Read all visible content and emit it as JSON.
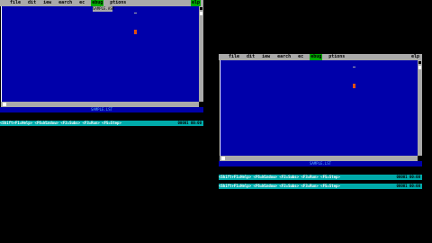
{
  "windows": [
    {
      "menu": [
        {
          "label": "file",
          "highlighted": false
        },
        {
          "label": "dit",
          "highlighted": false
        },
        {
          "label": "iew",
          "highlighted": false
        },
        {
          "label": "earch",
          "highlighted": false
        },
        {
          "label": "ec",
          "highlighted": false
        },
        {
          "label": "ebug",
          "highlighted": true
        },
        {
          "label": "ptions",
          "highlighted": false
        }
      ],
      "help_label": "elp",
      "title": "SAMPLE.ASM",
      "status_label": "SAMPLE.LST",
      "funcbars": [
        {
          "text": "<Shift+F1=Help> <F6=Window> <F2=Subs> <F3=Run> <F5=Step>",
          "right": "00001 00:00"
        }
      ]
    },
    {
      "menu": [
        {
          "label": "file",
          "highlighted": false
        },
        {
          "label": "dit",
          "highlighted": false
        },
        {
          "label": "iew",
          "highlighted": false
        },
        {
          "label": "earch",
          "highlighted": false
        },
        {
          "label": "ec",
          "highlighted": false
        },
        {
          "label": "ebug",
          "highlighted": true
        },
        {
          "label": "ptions",
          "highlighted": false
        }
      ],
      "help_label": "elp",
      "title": "SAMPLE.ASM",
      "status_label": "SAMPLE.LST",
      "funcbars": [
        {
          "text": "<Shift+F1=Help> <F6=Window> <F2=Subs> <F3=Run> <F5=Step>",
          "right": "00001 00:00"
        },
        {
          "text": "<Shift+F1=Help> <F6=Window> <F2=Subs> <F3=Run> <F5=Step>",
          "right": "00001 00:00"
        }
      ]
    }
  ],
  "colors": {
    "desktop": "#000000",
    "editor_bg": "#0000aa",
    "menu_bg": "#aaaaaa",
    "highlight": "#00aa00",
    "funcbar_bg": "#00aaaa",
    "cursor": "#e05010"
  }
}
